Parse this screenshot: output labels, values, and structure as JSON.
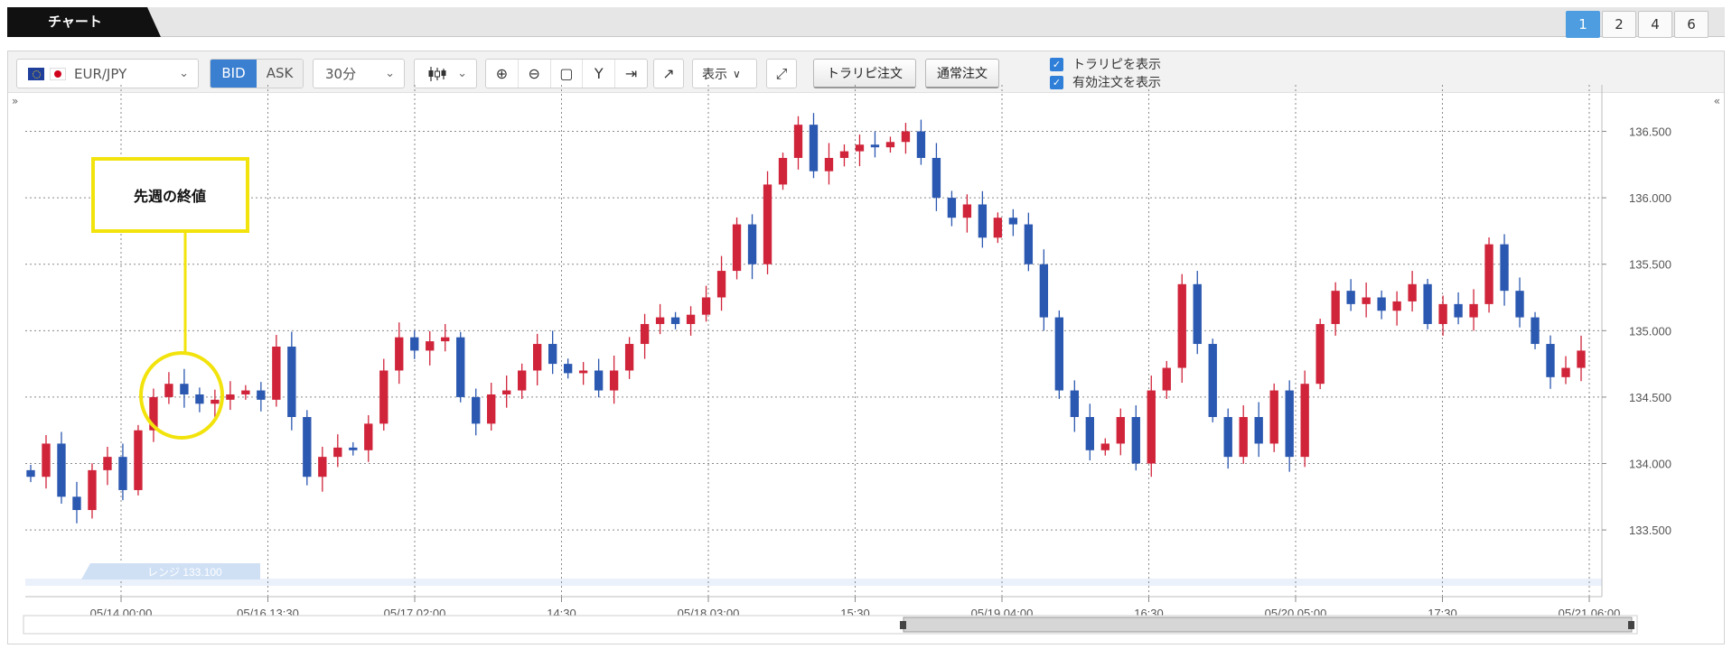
{
  "header": {
    "tab_label": "チャート",
    "pages": [
      "1",
      "2",
      "4",
      "6"
    ],
    "active_page": "1"
  },
  "toolbar": {
    "symbol": "EUR/JPY",
    "bid_label": "BID",
    "ask_label": "ASK",
    "period": "30分",
    "display_label": "表示",
    "trap_order_label": "トラリピ注文",
    "normal_order_label": "通常注文",
    "show_trap_label": "トラリピを表示",
    "show_active_label": "有効注文を表示"
  },
  "annotation": {
    "callout_text": "先週の終値"
  },
  "range_label": "レンジ 133.100",
  "chart_data": {
    "type": "candlestick",
    "symbol": "EUR/JPY",
    "interval": "30分",
    "y_ticks": [
      "136.500",
      "136.000",
      "135.500",
      "135.000",
      "134.500",
      "134.000",
      "133.500"
    ],
    "ylim": [
      133.1,
      136.85
    ],
    "x_tick_labels": [
      "05/14 00:00",
      "05/16 13:30",
      "05/17 02:00",
      "14:30",
      "05/18 03:00",
      "15:30",
      "05/19 04:00",
      "16:30",
      "05/20 05:00",
      "17:30",
      "05/21 06:00"
    ],
    "grid": true,
    "up_color": "#d0243a",
    "down_color": "#2b58b0",
    "closes": [
      133.9,
      134.15,
      133.75,
      133.65,
      133.95,
      134.05,
      133.8,
      134.25,
      134.5,
      134.6,
      134.52,
      134.45,
      134.48,
      134.52,
      134.55,
      134.48,
      134.88,
      134.35,
      133.9,
      134.05,
      134.12,
      134.1,
      134.3,
      134.7,
      134.95,
      134.85,
      134.92,
      134.95,
      134.5,
      134.3,
      134.52,
      134.55,
      134.7,
      134.9,
      134.75,
      134.68,
      134.7,
      134.55,
      134.7,
      134.9,
      135.05,
      135.1,
      135.05,
      135.12,
      135.25,
      135.45,
      135.8,
      135.5,
      136.1,
      136.3,
      136.55,
      136.2,
      136.3,
      136.35,
      136.4,
      136.38,
      136.42,
      136.5,
      136.3,
      136.0,
      135.85,
      135.95,
      135.7,
      135.85,
      135.8,
      135.5,
      135.1,
      134.55,
      134.35,
      134.1,
      134.15,
      134.35,
      134.0,
      134.55,
      134.72,
      135.35,
      134.9,
      134.35,
      134.05,
      134.35,
      134.15,
      134.55,
      134.05,
      134.6,
      135.05,
      135.3,
      135.2,
      135.25,
      135.15,
      135.22,
      135.35,
      135.05,
      135.2,
      135.1,
      135.2,
      135.65,
      135.3,
      135.1,
      134.9,
      134.65,
      134.72,
      134.85
    ]
  }
}
